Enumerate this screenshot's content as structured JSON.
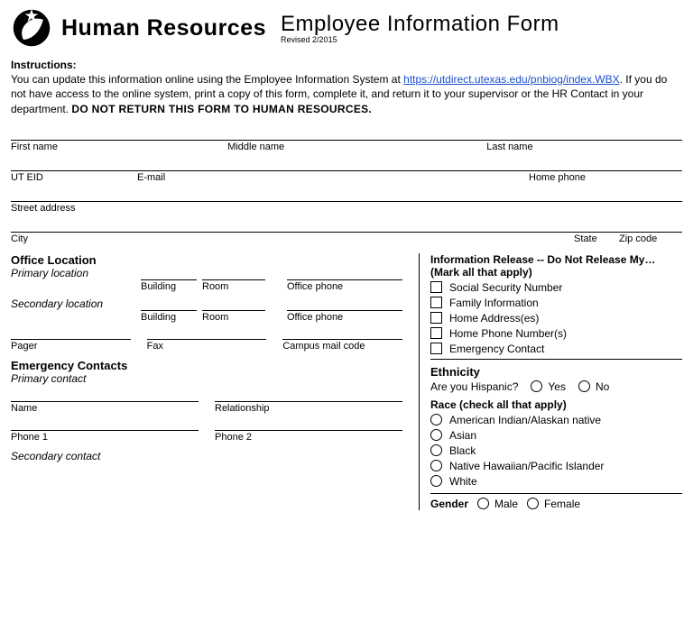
{
  "header": {
    "hr_title": "Human Resources",
    "form_title": "Employee Information Form",
    "revised": "Revised 2/2015"
  },
  "instructions": {
    "label": "Instructions:",
    "text_pre": "You can update this information online using the Employee Information System at ",
    "link_text": "https://utdirect.utexas.edu/pnbiog/index.WBX",
    "text_mid": ". If you do not have access to the online system, print a copy of this form, complete it, and return it to your supervisor or the HR Contact in your department. ",
    "bold_text": "DO NOT RETURN THIS FORM TO HUMAN RESOURCES."
  },
  "row1": {
    "first": "First name",
    "middle": "Middle name",
    "last": "Last name"
  },
  "row2": {
    "uteid": "UT EID",
    "email": "E-mail",
    "homephone": "Home phone"
  },
  "row3": {
    "street": "Street address"
  },
  "row4": {
    "city": "City",
    "state": "State",
    "zip": "Zip code"
  },
  "office": {
    "heading": "Office Location",
    "primary": "Primary location",
    "secondary": "Secondary location",
    "building": "Building",
    "room": "Room",
    "office_phone": "Office phone",
    "pager": "Pager",
    "fax": "Fax",
    "campus_mail": "Campus mail code"
  },
  "emergency": {
    "heading": "Emergency Contacts",
    "primary": "Primary contact",
    "secondary": "Secondary contact",
    "name": "Name",
    "relationship": "Relationship",
    "phone1": "Phone 1",
    "phone2": "Phone 2"
  },
  "info_release": {
    "heading": "Information Release -- Do Not Release My…",
    "sub": "(Mark all that apply)",
    "items": [
      "Social Security Number",
      "Family Information",
      "Home Address(es)",
      "Home Phone Number(s)",
      "Emergency Contact"
    ]
  },
  "ethnicity": {
    "heading": "Ethnicity",
    "question": "Are you Hispanic?",
    "yes": "Yes",
    "no": "No"
  },
  "race": {
    "heading": "Race (check all that apply)",
    "items": [
      "American Indian/Alaskan native",
      "Asian",
      "Black",
      "Native Hawaiian/Pacific Islander",
      "White"
    ]
  },
  "gender": {
    "heading": "Gender",
    "male": "Male",
    "female": "Female"
  }
}
